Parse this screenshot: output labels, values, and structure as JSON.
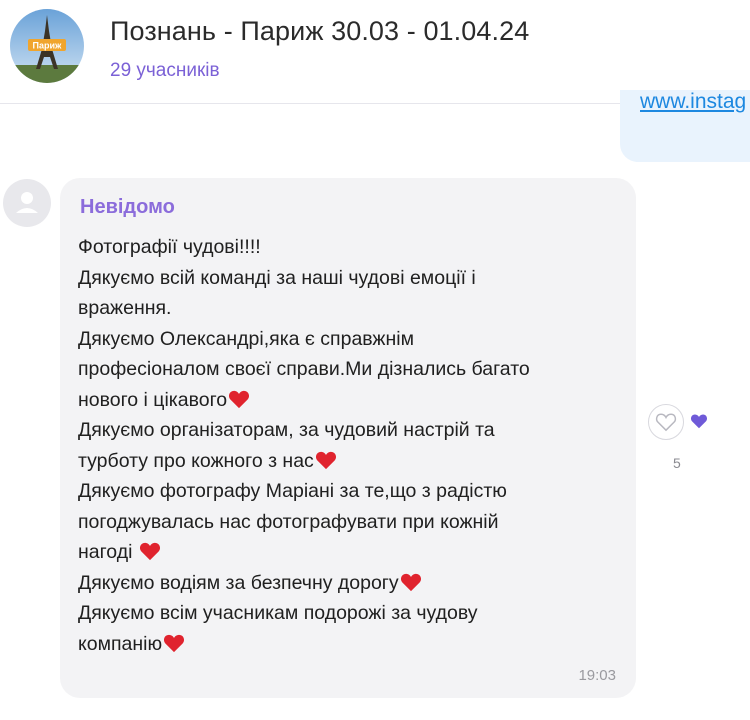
{
  "header": {
    "title": "Познань - Париж 30.03 - 01.04.24",
    "participants": "29 учасників",
    "avatar_text": "Париж"
  },
  "previous_message": {
    "link_text": "www.instag"
  },
  "message": {
    "sender": "Невідомо",
    "lines": [
      "Фотографії чудові!!!!",
      "Дякуємо всій команді за наші чудові емоції і",
      "враження.",
      "Дякуємо Олександрі,яка є справжнім",
      "професіоналом своєї справи.Ми дізнались багато",
      "нового і цікавого",
      "Дякуємо організаторам, за чудовий настрій та",
      "турботу про кожного з нас",
      "Дякуємо фотографу Маріані за те,що з радістю",
      "погоджувалась нас фотографувати при кожній",
      "нагоді ",
      "Дякуємо водіям за безпечну дорогу",
      "Дякуємо всім учасникам подорожі за чудову",
      "компанію"
    ],
    "time": "19:03"
  },
  "reactions": {
    "count": "5",
    "heart_color": "#e0232e",
    "reaction_color": "#6f5ad8"
  }
}
